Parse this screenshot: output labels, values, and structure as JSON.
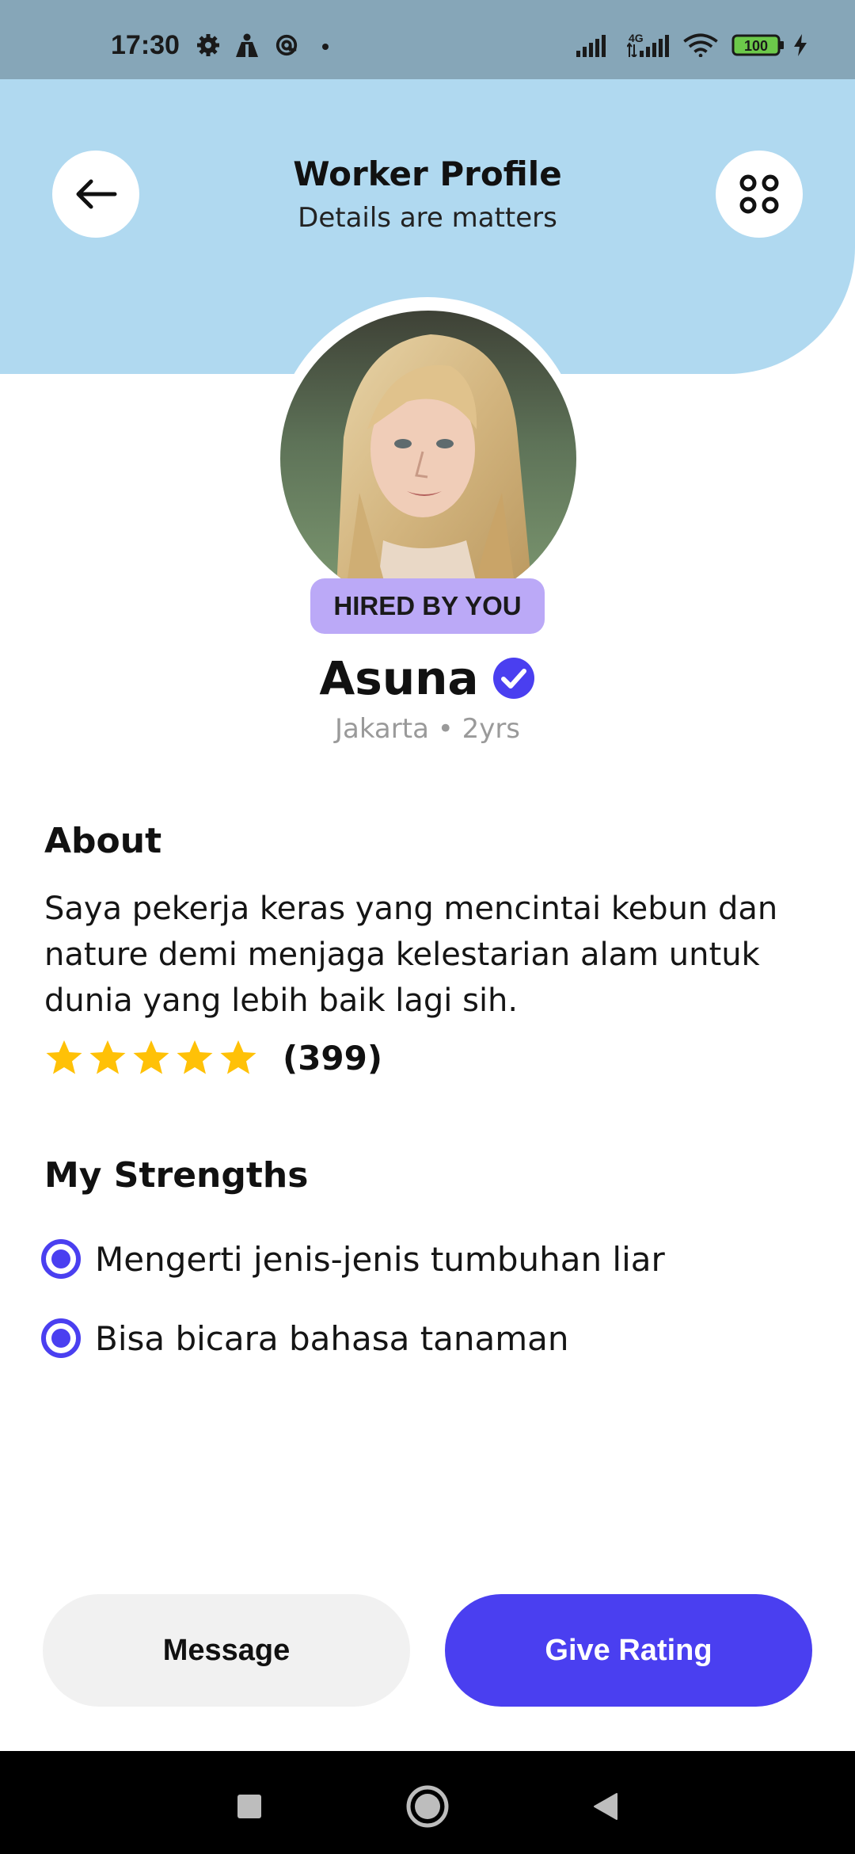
{
  "status_bar": {
    "time": "17:30",
    "battery_level": "100",
    "network_type": "4G"
  },
  "header": {
    "title": "Worker Profile",
    "subtitle": "Details are matters"
  },
  "profile": {
    "badge": "HIRED BY YOU",
    "name": "Asuna",
    "meta": "Jakarta • 2yrs"
  },
  "about": {
    "title": "About",
    "text": "Saya pekerja keras yang mencintai kebun dan nature demi menjaga kelestarian alam untuk dunia yang lebih baik lagi sih.",
    "rating_stars": 5,
    "rating_count": "(399)"
  },
  "strengths": {
    "title": "My Strengths",
    "items": [
      {
        "label": "Mengerti jenis-jenis tumbuhan liar"
      },
      {
        "label": "Bisa bicara bahasa tanaman"
      }
    ]
  },
  "actions": {
    "message_label": "Message",
    "rating_label": "Give Rating"
  },
  "colors": {
    "primary": "#4a3ff0",
    "header_bg": "#b0d9f0",
    "badge_bg": "#bba9f7",
    "star": "#ffc107",
    "status_bar_bg": "#86a6b8"
  },
  "icons": {
    "back": "arrow-left-icon",
    "menu": "four-dots-icon",
    "verified": "verified-check-icon",
    "star": "star-icon",
    "strength": "radio-selected-icon"
  }
}
